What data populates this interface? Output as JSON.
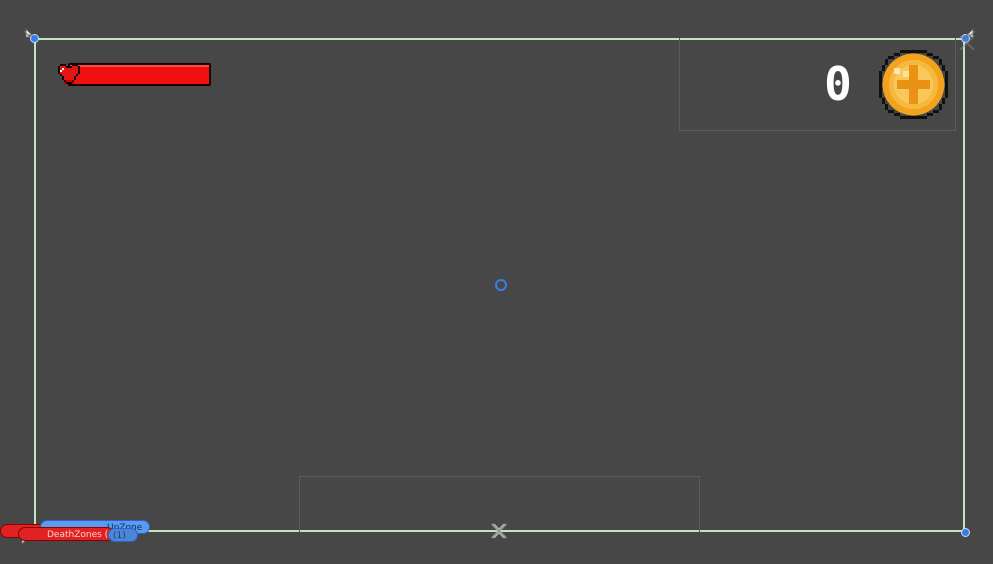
{
  "hud": {
    "health": {
      "icon": "heart-icon",
      "fill_fraction": 1.0,
      "color": "#f20f0f"
    },
    "coins": {
      "count": "0",
      "icon": "coin-icon",
      "color": "#f4a51f"
    }
  },
  "gizmos": {
    "labels": [
      {
        "text": "UpZone"
      },
      {
        "text": "DeathZones (1)"
      },
      {
        "text": "(1)"
      }
    ],
    "frame_color": "#bfe7bf",
    "handle_color": "#3a7ee3"
  }
}
